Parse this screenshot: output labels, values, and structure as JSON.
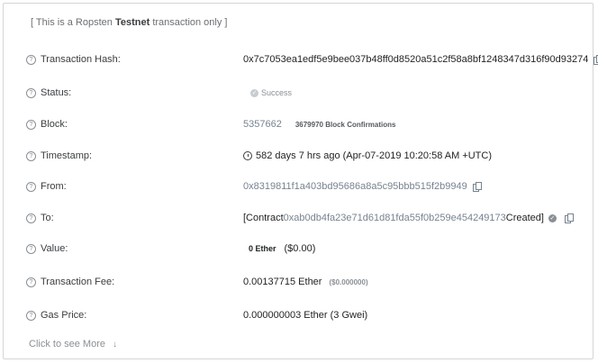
{
  "notice": {
    "prefix": "[ This is a Ropsten ",
    "network": "Testnet",
    "suffix": " transaction only ]"
  },
  "rows": {
    "hash": {
      "label": "Transaction Hash:",
      "value": "0x7c7053ea1edf5e9bee037b48ff0d8520a51c2f58a8bf1248347d316f90d93274"
    },
    "status": {
      "label": "Status:",
      "value": "Success"
    },
    "block": {
      "label": "Block:",
      "value": "5357662",
      "confirmations": "3679970 Block Confirmations"
    },
    "timestamp": {
      "label": "Timestamp:",
      "value": "582 days 7 hrs ago (Apr-07-2019 10:20:58 AM +UTC)"
    },
    "from": {
      "label": "From:",
      "value": "0x8319811f1a403bd95686a8a5c95bbb515f2b9949"
    },
    "to": {
      "label": "To:",
      "prefix": "[Contract ",
      "address": "0xab0db4fa23e71d61d81fda55f0b259e454249173",
      "suffix": " Created]"
    },
    "value": {
      "label": "Value:",
      "amount": "0 Ether",
      "usd": "($0.00)"
    },
    "fee": {
      "label": "Transaction Fee:",
      "amount": "0.00137715 Ether",
      "usd": "($0.000000)"
    },
    "gas": {
      "label": "Gas Price:",
      "value": "0.000000003 Ether (3 Gwei)"
    }
  },
  "more": {
    "label": "Click to see More"
  },
  "icons": {
    "help": "question-circle-icon",
    "copy": "copy-icon",
    "check": "check-circle-icon",
    "clock": "clock-icon",
    "arrow": "arrow-down-icon"
  }
}
